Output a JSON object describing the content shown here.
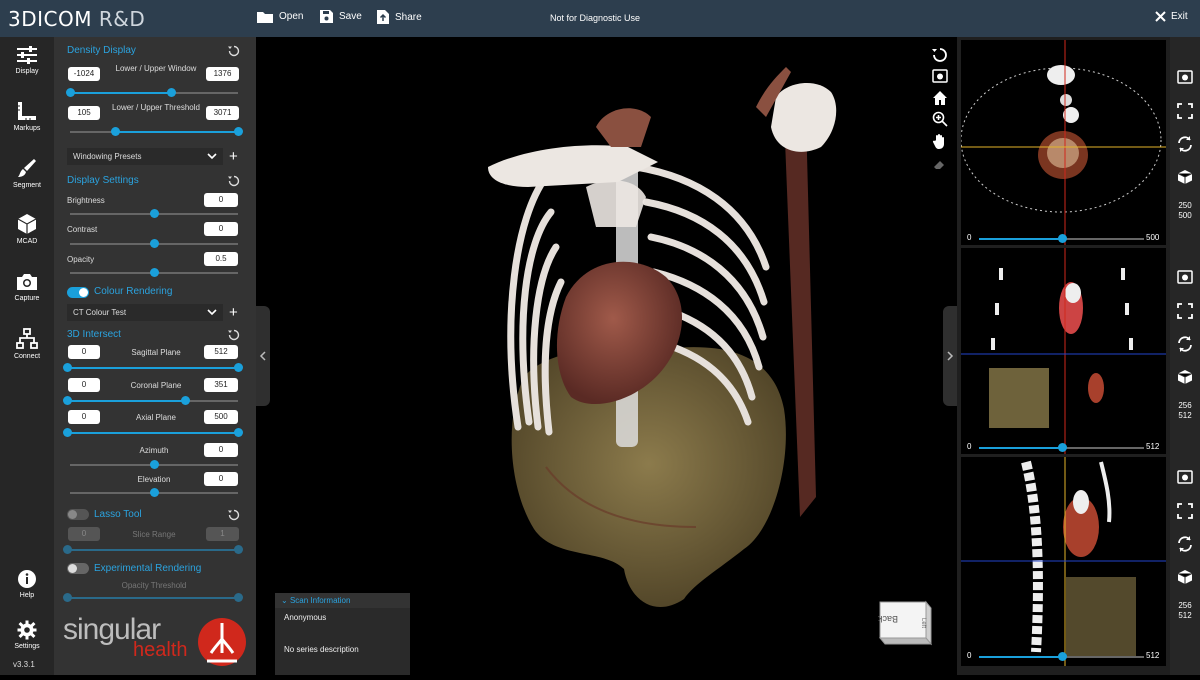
{
  "app": {
    "brand_main": "3DICOM",
    "brand_suffix": "R&D",
    "open_label": "Open",
    "save_label": "Save",
    "share_label": "Share",
    "notice": "Not for Diagnostic Use",
    "exit_label": "Exit",
    "version": "v3.3.1"
  },
  "rail": {
    "display": "Display",
    "markups": "Markups",
    "segment": "Segment",
    "mcad": "MCAD",
    "capture": "Capture",
    "connect": "Connect",
    "help": "Help",
    "settings": "Settings"
  },
  "panel": {
    "density_title": "Density Display",
    "window_lower": "-1024",
    "window_label": "Lower / Upper Window",
    "window_upper": "1376",
    "window_range": [
      0.0,
      0.6
    ],
    "threshold_lower": "105",
    "threshold_label": "Lower / Upper Threshold",
    "threshold_upper": "3071",
    "threshold_range": [
      0.27,
      1.0
    ],
    "windowing_presets": "Windowing Presets",
    "display_settings_title": "Display Settings",
    "brightness_label": "Brightness",
    "brightness_value": "0",
    "brightness_level": 0.5,
    "contrast_label": "Contrast",
    "contrast_value": "0",
    "contrast_level": 0.5,
    "opacity_label": "Opacity",
    "opacity_value": "0.5",
    "opacity_level": 0.5,
    "colour_rendering_label": "Colour Rendering",
    "colour_rendering_on": true,
    "colour_preset": "CT Colour Test",
    "intersect_title": "3D Intersect",
    "sagittal_lower": "0",
    "sagittal_label": "Sagittal Plane",
    "sagittal_upper": "512",
    "sagittal_range": [
      0.0,
      1.0
    ],
    "coronal_lower": "0",
    "coronal_label": "Coronal Plane",
    "coronal_upper": "351",
    "coronal_range": [
      0.0,
      0.69
    ],
    "axial_lower": "0",
    "axial_label": "Axial Plane",
    "axial_upper": "500",
    "axial_range": [
      0.0,
      1.0
    ],
    "azimuth_label": "Azimuth",
    "azimuth_value": "0",
    "azimuth_level": 0.5,
    "elevation_label": "Elevation",
    "elevation_value": "0",
    "elevation_level": 0.5,
    "lasso_label": "Lasso Tool",
    "lasso_on": false,
    "slice_range_lower": "0",
    "slice_range_label": "Slice Range",
    "slice_range_upper": "1",
    "experimental_label": "Experimental Rendering",
    "experimental_on": false,
    "opacity_threshold_label": "Opacity Threshold",
    "logo_text_top": "singular",
    "logo_text_bottom": "health"
  },
  "scan_info": {
    "header": "Scan Information",
    "patient": "Anonymous",
    "series": "No series description"
  },
  "orientation_cube": {
    "face_front": "Back",
    "face_side": "Left"
  },
  "slices": [
    {
      "view": "axial",
      "min": "0",
      "max": "500",
      "position": 0.5,
      "counter_top": "250",
      "counter_bottom": "500"
    },
    {
      "view": "coronal",
      "min": "0",
      "max": "512",
      "position": 0.5,
      "counter_top": "256",
      "counter_bottom": "512"
    },
    {
      "view": "sagittal",
      "min": "0",
      "max": "512",
      "position": 0.5,
      "counter_top": "256",
      "counter_bottom": "512"
    }
  ],
  "colors": {
    "accent": "#1aa0db",
    "topbar": "#2d3e4e",
    "panel": "#333333",
    "bone": "#e8e2dc",
    "tissue": "#8e5044",
    "liver": "#8a7a4a",
    "crosshair_red": "#d0281c",
    "crosshair_blue": "#2244cc",
    "crosshair_yellow": "#e5b52a",
    "logo_red": "#d0281c"
  }
}
